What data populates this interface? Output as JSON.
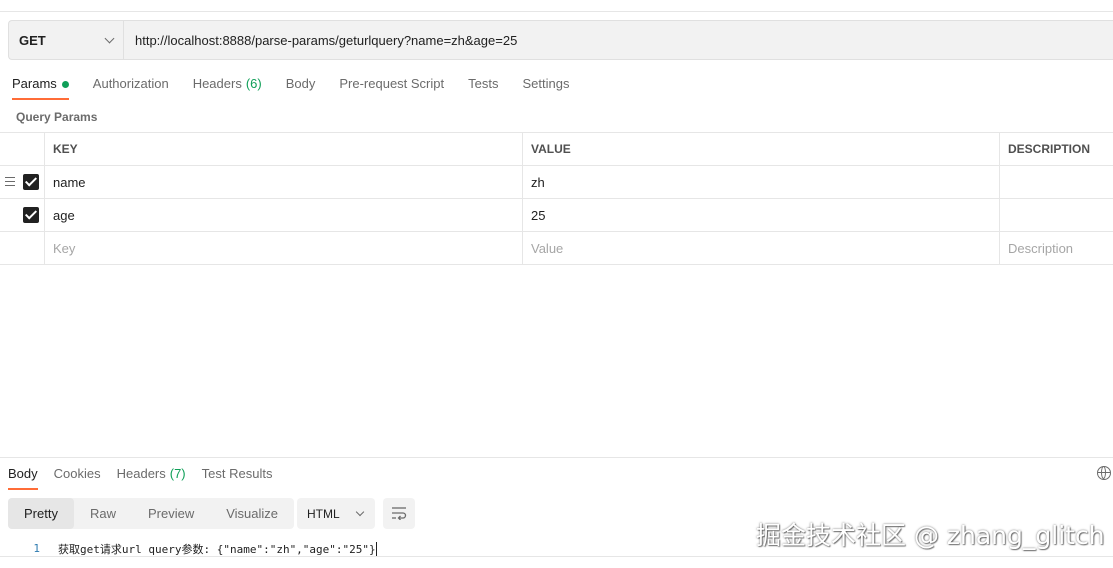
{
  "request": {
    "method": "GET",
    "url": "http://localhost:8888/parse-params/geturlquery?name=zh&age=25"
  },
  "request_tabs": [
    {
      "label": "Params"
    },
    {
      "label": "Authorization"
    },
    {
      "label": "Headers",
      "count": "(6)"
    },
    {
      "label": "Body"
    },
    {
      "label": "Pre-request Script"
    },
    {
      "label": "Tests"
    },
    {
      "label": "Settings"
    }
  ],
  "query_params": {
    "title": "Query Params",
    "columns": [
      "KEY",
      "VALUE",
      "DESCRIPTION"
    ],
    "rows": [
      {
        "key": "name",
        "value": "zh",
        "description": "",
        "checked": true
      },
      {
        "key": "age",
        "value": "25",
        "description": "",
        "checked": true
      }
    ],
    "placeholders": {
      "key": "Key",
      "value": "Value",
      "description": "Description"
    }
  },
  "response_tabs": [
    {
      "label": "Body"
    },
    {
      "label": "Cookies"
    },
    {
      "label": "Headers",
      "count": "(7)"
    },
    {
      "label": "Test Results"
    }
  ],
  "response_view": {
    "modes": [
      "Pretty",
      "Raw",
      "Preview",
      "Visualize"
    ],
    "active_mode": "Pretty",
    "format": "HTML"
  },
  "response_body": {
    "line_number": "1",
    "text": "获取get请求url query参数: {\"name\":\"zh\",\"age\":\"25\"}"
  },
  "watermark": "掘金技术社区 @ zhang_glitch",
  "colors": {
    "accent": "#ff6c37",
    "success": "#0f9f58"
  },
  "icons": {
    "method_dropdown": "chevron-down-icon",
    "drag": "drag-handle-icon",
    "globe": "globe-icon",
    "wrap": "wrap-lines-icon"
  }
}
